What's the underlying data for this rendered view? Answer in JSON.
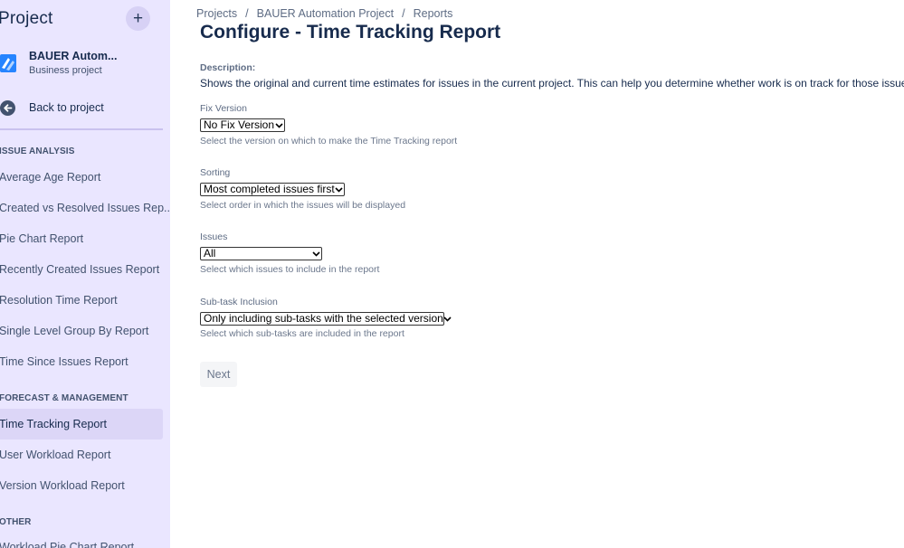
{
  "sidebar": {
    "title": "Project",
    "project_name": "BAUER Autom...",
    "project_type": "Business project",
    "back_label": "Back to project",
    "sections": {
      "issue_analysis": "ISSUE ANALYSIS",
      "forecast": "FORECAST & MANAGEMENT",
      "other": "OTHER"
    },
    "issue_analysis_items": [
      "Average Age Report",
      "Created vs Resolved Issues Rep...",
      "Pie Chart Report",
      "Recently Created Issues Report",
      "Resolution Time Report",
      "Single Level Group By Report",
      "Time Since Issues Report"
    ],
    "forecast_items": [
      "Time Tracking Report",
      "User Workload Report",
      "Version Workload Report"
    ],
    "other_items": [
      "Workload Pie Chart Report"
    ]
  },
  "breadcrumb": [
    "Projects",
    "BAUER Automation Project",
    "Reports"
  ],
  "page_title": "Configure - Time Tracking Report",
  "description": {
    "label": "Description:",
    "text": "Shows the original and current time estimates for issues in the current project. This can help you determine whether work is on track for those issues."
  },
  "fields": {
    "fix_version": {
      "label": "Fix Version",
      "value": "No Fix Version",
      "help": "Select the version on which to make the Time Tracking report"
    },
    "sorting": {
      "label": "Sorting",
      "value": "Most completed issues first",
      "help": "Select order in which the issues will be displayed"
    },
    "issues": {
      "label": "Issues",
      "value": "All",
      "help": "Select which issues to include in the report"
    },
    "subtask": {
      "label": "Sub-task Inclusion",
      "value": "Only including sub-tasks with the selected version",
      "help": "Select which sub-tasks are included in the report"
    }
  },
  "next_label": "Next",
  "colors": {
    "sidebar_bg": "#eae6ff",
    "sidebar_active": "#dcd6f7",
    "text_primary": "#172b4d",
    "text_secondary": "#5e6c84"
  }
}
